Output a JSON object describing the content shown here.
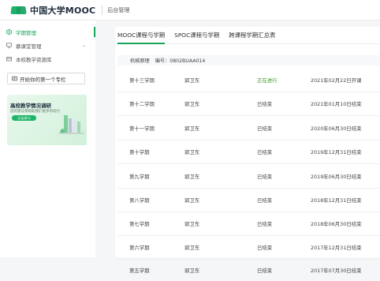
{
  "header": {
    "logo_text": "中国大学MOOC",
    "subtitle": "后台管理",
    "brand_color": "#1eb36b"
  },
  "sidebar": {
    "items": [
      {
        "label": "学期管理",
        "icon": "hexagon-icon",
        "active": true
      },
      {
        "label": "慕课堂管理",
        "icon": "monitor-icon",
        "expandable": true
      },
      {
        "label": "本校教学资源库",
        "icon": "library-icon"
      }
    ],
    "column_button": {
      "label": "开始你的第一个专栏",
      "icon": "column-icon"
    },
    "banner": {
      "title": "高校教学情况调研",
      "subtitle": "您的建议将帮助我们进步的动力",
      "button": "点击参与"
    }
  },
  "main": {
    "tabs": [
      {
        "label": "MOOC课程与学期",
        "active": true
      },
      {
        "label": "SPOC课程与学期",
        "active": false
      },
      {
        "label": "跨课程学期汇总表",
        "active": false
      }
    ],
    "course": {
      "name": "机械原理",
      "code": "编号：0802BUAA014"
    },
    "terms": [
      {
        "term": "第十三学期",
        "teacher": "郭卫东",
        "status": "正在进行",
        "end": "2021年02月22日开课"
      },
      {
        "term": "第十二学期",
        "teacher": "郭卫东",
        "status": "已结束",
        "end": "2021年01月10日结束"
      },
      {
        "term": "第十一学期",
        "teacher": "郭卫东",
        "status": "已结束",
        "end": "2020年06月30日结束"
      },
      {
        "term": "第十学期",
        "teacher": "郭卫东",
        "status": "已结束",
        "end": "2019年12月31日结束"
      },
      {
        "term": "第九学期",
        "teacher": "郭卫东",
        "status": "已结束",
        "end": "2019年06月30日结束"
      },
      {
        "term": "第八学期",
        "teacher": "郭卫东",
        "status": "已结束",
        "end": "2018年12月31日结束"
      },
      {
        "term": "第七学期",
        "teacher": "郭卫东",
        "status": "已结束",
        "end": "2018年06月30日结束"
      },
      {
        "term": "第六学期",
        "teacher": "郭卫东",
        "status": "已结束",
        "end": "2017年12月31日结束"
      },
      {
        "term": "第五学期",
        "teacher": "郭卫东",
        "status": "已结束",
        "end": "2017年07月30日结束"
      }
    ]
  }
}
